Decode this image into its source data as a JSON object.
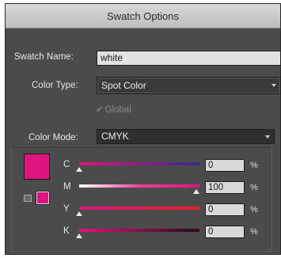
{
  "dialog": {
    "title": "Swatch Options"
  },
  "swatch_name": {
    "label": "Swatch Name:",
    "value": "white"
  },
  "color_type": {
    "label": "Color Type:",
    "value": "Spot Color"
  },
  "global_checkbox": {
    "label": "Global",
    "checked": true,
    "enabled": false
  },
  "color_mode": {
    "label": "Color Mode:",
    "value": "CMYK"
  },
  "swatch_color": "#e0147e",
  "channels": [
    {
      "letter": "C",
      "value": "0",
      "unit": "%"
    },
    {
      "letter": "M",
      "value": "100",
      "unit": "%"
    },
    {
      "letter": "Y",
      "value": "0",
      "unit": "%"
    },
    {
      "letter": "K",
      "value": "0",
      "unit": "%"
    }
  ]
}
